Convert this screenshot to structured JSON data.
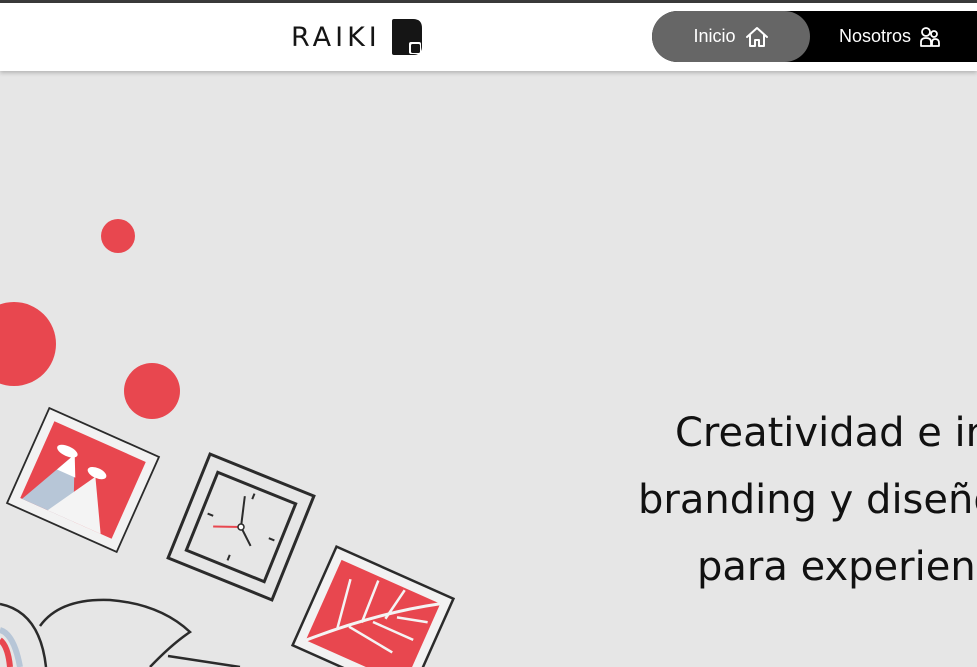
{
  "header": {
    "logo_text": "RAIKI",
    "nav": {
      "inicio": {
        "label": "Inicio",
        "icon": "home-icon"
      },
      "nosotros": {
        "label": "Nosotros",
        "icon": "users-icon"
      }
    }
  },
  "hero": {
    "lines": [
      "Creatividad e in",
      "branding y diseño",
      "para experienc"
    ]
  },
  "colors": {
    "accent_red": "#e8474f",
    "nav_dark": "#000000",
    "nav_active": "#666666",
    "background": "#e6e6e6"
  }
}
